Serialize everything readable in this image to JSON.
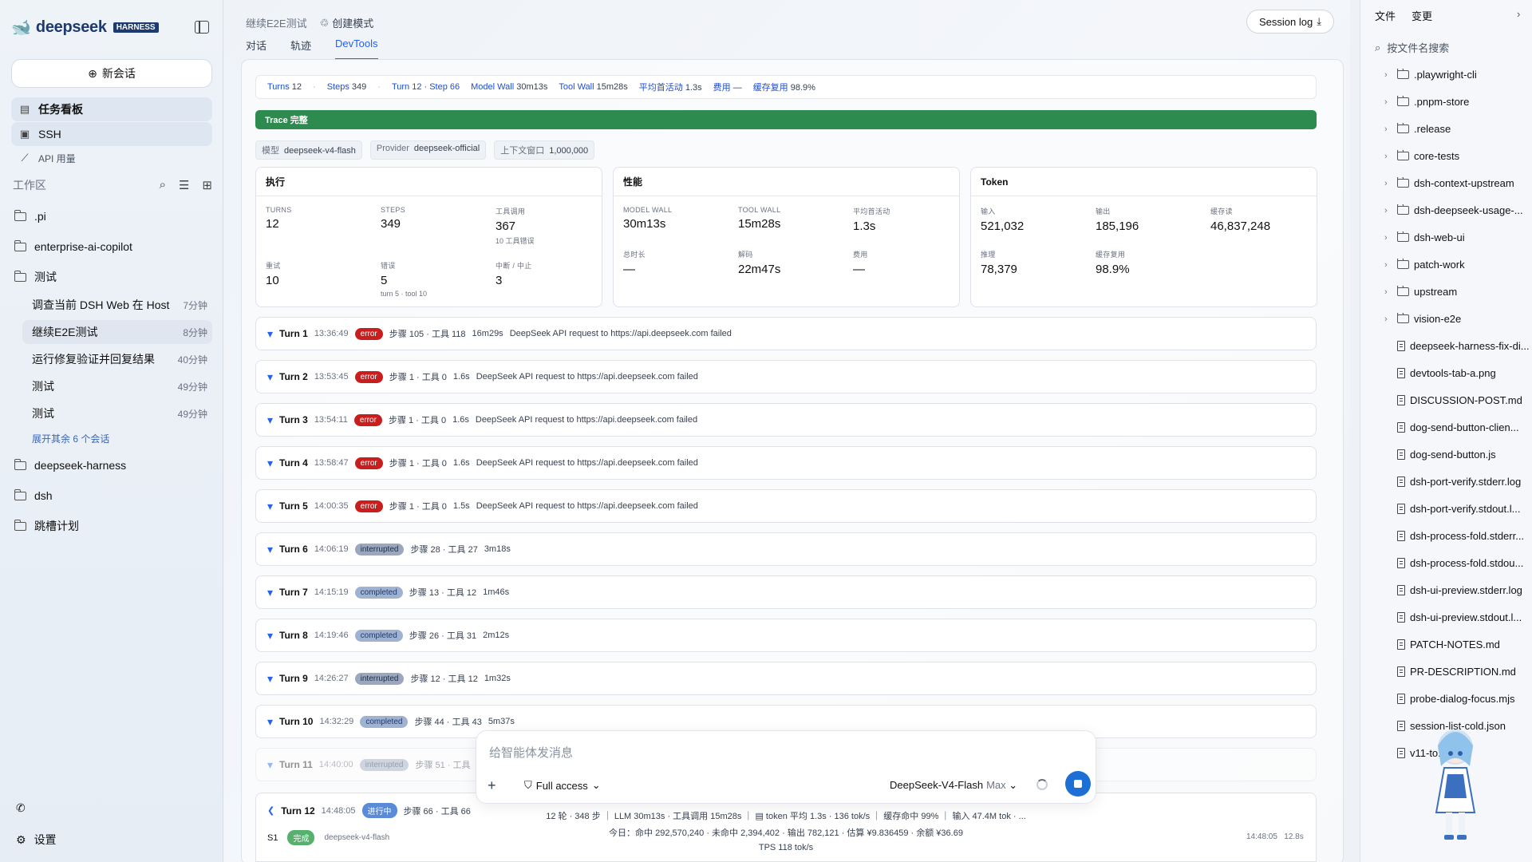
{
  "sidebar": {
    "brand": "deepseek",
    "brand_badge": "HARNESS",
    "new_chat": "新会话",
    "nav": [
      {
        "label": "任务看板",
        "active": true
      },
      {
        "label": "SSH",
        "active": true
      },
      {
        "label": "API 用量",
        "active": false
      }
    ],
    "workspace_label": "工作区",
    "folders_top": [
      ".pi",
      "enterprise-ai-copilot",
      "测试"
    ],
    "sessions": [
      {
        "title": "调查当前 DSH Web 在 Host",
        "time": "7分钟",
        "active": false
      },
      {
        "title": "继续E2E测试",
        "time": "8分钟",
        "active": true
      },
      {
        "title": "运行修复验证并回复结果",
        "time": "40分钟",
        "active": false
      },
      {
        "title": "测试",
        "time": "49分钟",
        "active": false
      },
      {
        "title": "测试",
        "time": "49分钟",
        "active": false
      }
    ],
    "expand_more": "展开其余 6 个会话",
    "folders_bottom": [
      "deepseek-harness",
      "dsh",
      "跳槽计划"
    ],
    "settings": "设置"
  },
  "header": {
    "title": "继续E2E测试",
    "mode": "创建模式",
    "tabs": [
      "对话",
      "轨迹",
      "DevTools"
    ],
    "active_tab": 2,
    "session_log": "Session log"
  },
  "summary": {
    "turns_label": "Turns",
    "turns": "12",
    "steps_label": "Steps",
    "steps": "349",
    "position": "Turn 12 · Step 66",
    "model_wall_label": "Model Wall",
    "model_wall": "30m13s",
    "tool_wall_label": "Tool Wall",
    "tool_wall": "15m28s",
    "avg_label": "平均首活动",
    "avg": "1.3s",
    "cost_label": "费用",
    "cost": "—",
    "cache_label": "缓存复用",
    "cache": "98.9%"
  },
  "trace": "Trace 完整",
  "chips": [
    {
      "k": "模型",
      "v": "deepseek-v4-flash"
    },
    {
      "k": "Provider",
      "v": "deepseek-official"
    },
    {
      "k": "上下文窗口",
      "v": "1,000,000"
    }
  ],
  "cards": {
    "exec": {
      "title": "执行",
      "cells": [
        {
          "l": "TURNS",
          "v": "12",
          "s": ""
        },
        {
          "l": "STEPS",
          "v": "349",
          "s": ""
        },
        {
          "l": "工具调用",
          "v": "367",
          "s": "10 工具错误"
        },
        {
          "l": "重试",
          "v": "10",
          "s": ""
        },
        {
          "l": "错误",
          "v": "5",
          "s": "turn 5 · tool 10"
        },
        {
          "l": "中断 / 中止",
          "v": "3",
          "s": ""
        }
      ]
    },
    "perf": {
      "title": "性能",
      "cells": [
        {
          "l": "MODEL WALL",
          "v": "30m13s",
          "s": ""
        },
        {
          "l": "TOOL WALL",
          "v": "15m28s",
          "s": ""
        },
        {
          "l": "平均首活动",
          "v": "1.3s",
          "s": ""
        },
        {
          "l": "总时长",
          "v": "—",
          "s": ""
        },
        {
          "l": "解码",
          "v": "22m47s",
          "s": ""
        },
        {
          "l": "费用",
          "v": "—",
          "s": ""
        }
      ]
    },
    "token": {
      "title": "Token",
      "cells": [
        {
          "l": "输入",
          "v": "521,032",
          "s": ""
        },
        {
          "l": "输出",
          "v": "185,196",
          "s": ""
        },
        {
          "l": "缓存读",
          "v": "46,837,248",
          "s": ""
        },
        {
          "l": "推理",
          "v": "78,379",
          "s": ""
        },
        {
          "l": "缓存复用",
          "v": "98.9%",
          "s": ""
        }
      ]
    }
  },
  "turns": [
    {
      "name": "Turn 1",
      "time": "13:36:49",
      "status": "error",
      "stats": "步骤 105 · 工具 118",
      "dur": "16m29s",
      "msg": "DeepSeek API request to https://api.deepseek.com failed"
    },
    {
      "name": "Turn 2",
      "time": "13:53:45",
      "status": "error",
      "stats": "步骤 1 · 工具 0",
      "dur": "1.6s",
      "msg": "DeepSeek API request to https://api.deepseek.com failed"
    },
    {
      "name": "Turn 3",
      "time": "13:54:11",
      "status": "error",
      "stats": "步骤 1 · 工具 0",
      "dur": "1.6s",
      "msg": "DeepSeek API request to https://api.deepseek.com failed"
    },
    {
      "name": "Turn 4",
      "time": "13:58:47",
      "status": "error",
      "stats": "步骤 1 · 工具 0",
      "dur": "1.6s",
      "msg": "DeepSeek API request to https://api.deepseek.com failed"
    },
    {
      "name": "Turn 5",
      "time": "14:00:35",
      "status": "error",
      "stats": "步骤 1 · 工具 0",
      "dur": "1.5s",
      "msg": "DeepSeek API request to https://api.deepseek.com failed"
    },
    {
      "name": "Turn 6",
      "time": "14:06:19",
      "status": "interrupted",
      "stats": "步骤 28 · 工具 27",
      "dur": "3m18s",
      "msg": ""
    },
    {
      "name": "Turn 7",
      "time": "14:15:19",
      "status": "completed",
      "stats": "步骤 13 · 工具 12",
      "dur": "1m46s",
      "msg": ""
    },
    {
      "name": "Turn 8",
      "time": "14:19:46",
      "status": "completed",
      "stats": "步骤 26 · 工具 31",
      "dur": "2m12s",
      "msg": ""
    },
    {
      "name": "Turn 9",
      "time": "14:26:27",
      "status": "interrupted",
      "stats": "步骤 12 · 工具 12",
      "dur": "1m32s",
      "msg": ""
    },
    {
      "name": "Turn 10",
      "time": "14:32:29",
      "status": "completed",
      "stats": "步骤 44 · 工具 43",
      "dur": "5m37s",
      "msg": ""
    },
    {
      "name": "Turn 11",
      "time": "14:40:00",
      "status": "interrupted",
      "stats": "步骤 51 · 工具",
      "dur": "",
      "msg": ""
    }
  ],
  "turn12": {
    "name": "Turn 12",
    "time": "14:48:05",
    "status": "进行中",
    "stats": "步骤 66 · 工具 66",
    "step": "S1",
    "step_status": "完成",
    "step_model": "deepseek-v4-flash",
    "step_time": "14:48:05",
    "step_dur": "12.8s"
  },
  "composer": {
    "placeholder": "给智能体发消息",
    "access": "Full access",
    "model": "DeepSeek-V4-Flash",
    "level": "Max"
  },
  "status": {
    "line1": "12 轮 · 348 步 ｜ LLM 30m13s · 工具调用 15m28s ｜ ▤ token 平均 1.3s · 136 tok/s ｜ 缓存命中 99% ｜ 输入 47.4M tok · ...",
    "line2": "今日：命中 292,570,240 · 未命中 2,394,402 · 输出 782,121 · 估算 ¥9.836459 · 余额 ¥36.69",
    "line3": "TPS 118 tok/s"
  },
  "files": {
    "tab_files": "文件",
    "tab_changes": "变更",
    "search": "按文件名搜索",
    "folders": [
      ".playwright-cli",
      ".pnpm-store",
      ".release",
      "core-tests",
      "dsh-context-upstream",
      "dsh-deepseek-usage-...",
      "dsh-web-ui",
      "patch-work",
      "upstream",
      "vision-e2e"
    ],
    "items": [
      "deepseek-harness-fix-di...",
      "devtools-tab-a.png",
      "DISCUSSION-POST.md",
      "dog-send-button-clien...",
      "dog-send-button.js",
      "dsh-port-verify.stderr.log",
      "dsh-port-verify.stdout.l...",
      "dsh-process-fold.stderr...",
      "dsh-process-fold.stdou...",
      "dsh-ui-preview.stderr.log",
      "dsh-ui-preview.stdout.l...",
      "PATCH-NOTES.md",
      "PR-DESCRIPTION.md",
      "probe-dialog-focus.mjs",
      "session-list-cold.json",
      "v11-to...png"
    ]
  }
}
